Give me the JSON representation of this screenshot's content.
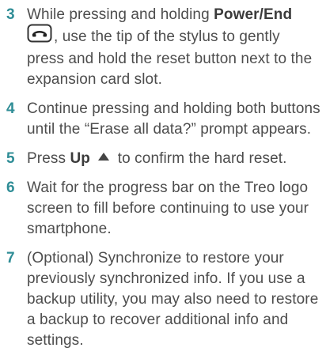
{
  "steps": [
    {
      "number": "3",
      "text_before": "While pressing and holding ",
      "bold": "Power/End",
      "icon": "phone-end-key-icon",
      "text_after": ", use the tip of the stylus to gently press and hold the reset button next to the expansion card slot."
    },
    {
      "number": "4",
      "text": "Continue pressing and holding both buttons until the “Erase all data?” prompt appears."
    },
    {
      "number": "5",
      "text_before": "Press ",
      "bold": "Up",
      "icon": "up-arrow-icon",
      "text_after": " to confirm the hard reset."
    },
    {
      "number": "6",
      "text": "Wait for the progress bar on the Treo logo screen to fill before continuing to use your smartphone."
    },
    {
      "number": "7",
      "text": "(Optional)  Synchronize to restore your previously synchronized info. If you use a backup utility, you may also need to restore a backup to recover additional info and settings."
    }
  ],
  "colors": {
    "step_number": "#2f8d96",
    "body_text": "#4d4d4d"
  }
}
